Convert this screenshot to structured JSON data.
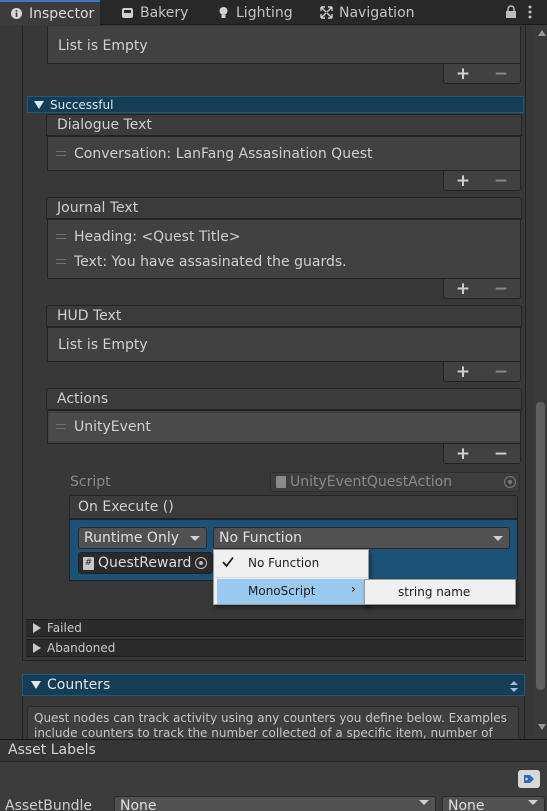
{
  "tabs": [
    {
      "label": "Inspector",
      "icon": "info-icon"
    },
    {
      "label": "Bakery",
      "icon": "bakery-icon"
    },
    {
      "label": "Lighting",
      "icon": "lightbulb-icon"
    },
    {
      "label": "Navigation",
      "icon": "navigation-icon"
    }
  ],
  "top_list": {
    "empty_text": "List is Empty"
  },
  "successful": {
    "label": "Successful",
    "dialogue_text": {
      "header": "Dialogue Text",
      "items": [
        "Conversation: LanFang Assasination Quest"
      ]
    },
    "journal_text": {
      "header": "Journal Text",
      "items": [
        "Heading: <Quest Title>",
        "Text: You have assasinated the guards."
      ]
    },
    "hud_text": {
      "header": "HUD Text",
      "empty_text": "List is Empty"
    },
    "actions": {
      "header": "Actions",
      "items": [
        "UnityEvent"
      ]
    },
    "script": {
      "label": "Script",
      "value": "UnityEventQuestAction"
    },
    "on_execute": {
      "header": "On Execute ()",
      "runtime": "Runtime Only",
      "function": "No Function",
      "target": "QuestReward"
    }
  },
  "popup_menu": {
    "items": [
      {
        "label": "No Function",
        "checked": true
      },
      {
        "label": "MonoScript",
        "has_submenu": true,
        "highlighted": true
      }
    ],
    "submenu": [
      {
        "label": "string name"
      }
    ]
  },
  "foldouts": [
    {
      "label": "Failed"
    },
    {
      "label": "Abandoned"
    }
  ],
  "counters": {
    "label": "Counters",
    "help_text_line1": "Quest nodes can track activity using any counters you define below. Examples",
    "help_text_line2": "include counters to track the number collected of a specific item, number of"
  },
  "asset_labels": {
    "title": "Asset Labels",
    "assetbundle_label": "AssetBundle",
    "bundle_value": "None",
    "variant_value": "None"
  },
  "colors": {
    "accent": "#3a79bb",
    "header_blue": "#153d55",
    "panel": "#414141"
  }
}
